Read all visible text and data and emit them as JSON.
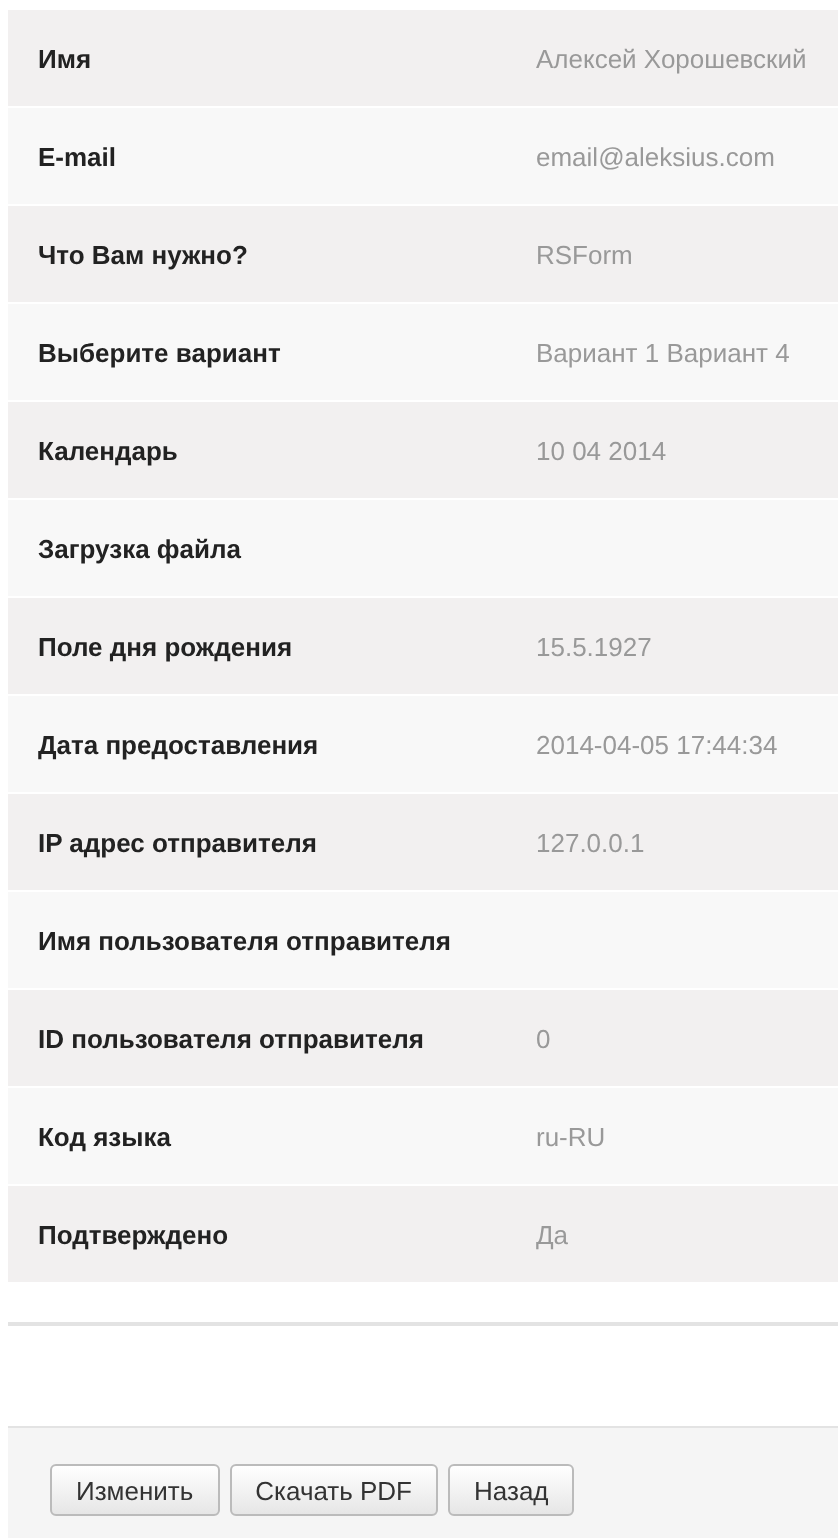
{
  "rows": [
    {
      "label": "Имя",
      "value": "Алексей Хорошевский"
    },
    {
      "label": "E-mail",
      "value": "email@aleksius.com"
    },
    {
      "label": "Что Вам нужно?",
      "value": "RSForm"
    },
    {
      "label": "Выберите вариант",
      "value": "Вариант 1 Вариант 4"
    },
    {
      "label": "Календарь",
      "value": "10 04 2014"
    },
    {
      "label": "Загрузка файла"
    },
    {
      "label": "Поле дня рождения",
      "value": "15.5.1927"
    },
    {
      "label": "Дата предоставления",
      "value": "2014-04-05 17:44:34"
    },
    {
      "label": "IP адрес отправителя",
      "value": "127.0.0.1"
    },
    {
      "label": "Имя пользователя отправителя"
    },
    {
      "label": "ID пользователя отправителя",
      "value": "0"
    },
    {
      "label": "Код языка",
      "value": "ru-RU"
    },
    {
      "label": "Подтверждено",
      "value": "Да"
    }
  ],
  "buttons": [
    "Изменить",
    "Скачать PDF",
    "Назад"
  ]
}
